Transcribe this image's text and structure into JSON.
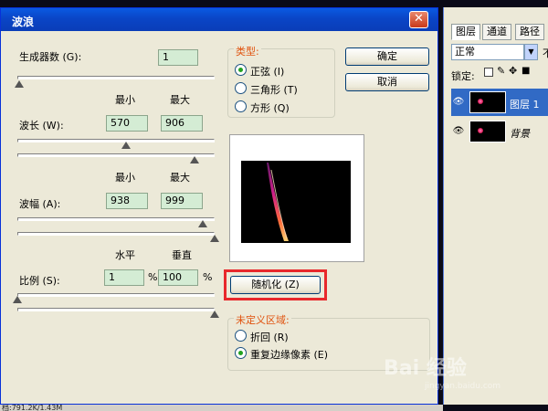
{
  "dialog": {
    "title": "波浪",
    "close_glyph": "✕",
    "generators": {
      "label": "生成器数 (G):",
      "value": "1"
    },
    "wavelength": {
      "label": "波长 (W):",
      "min_header": "最小",
      "max_header": "最大",
      "min": "570",
      "max": "906",
      "min_level": 0.55,
      "max_level": 0.9
    },
    "amplitude": {
      "label": "波幅 (A):",
      "min_header": "最小",
      "max_header": "最大",
      "min": "938",
      "max": "999",
      "min_level": 0.94,
      "max_level": 1.0
    },
    "scale": {
      "label": "比例 (S):",
      "h_header": "水平",
      "v_header": "垂直",
      "h": "1",
      "v": "100",
      "unit": "%",
      "h_level": 0.0,
      "v_level": 1.0
    },
    "type_group": {
      "title": "类型:",
      "options": [
        {
          "label": "正弦 (I)",
          "selected": true
        },
        {
          "label": "三角形 (T)",
          "selected": false
        },
        {
          "label": "方形 (Q)",
          "selected": false
        }
      ]
    },
    "ok_label": "确定",
    "cancel_label": "取消",
    "randomize_label": "随机化 (Z)",
    "undefined_group": {
      "title": "未定义区域:",
      "options": [
        {
          "label": "折回 (R)",
          "selected": false
        },
        {
          "label": "重复边缘像素 (E)",
          "selected": true
        }
      ]
    }
  },
  "panel": {
    "tabs": [
      "图层",
      "通道",
      "路径"
    ],
    "blend_mode": "正常",
    "opacity_label": "不",
    "lock_label": "锁定:",
    "layers": [
      {
        "name": "图层 1",
        "selected": true
      },
      {
        "name": "背景",
        "selected": false
      }
    ]
  },
  "status": {
    "text": "档:791.2K/1.43M"
  },
  "watermark": {
    "main": "Bai 经验",
    "sub": "jingyan.baidu.com"
  },
  "colors": {
    "title_bar": "#0a45c6",
    "accent_orange": "#e0520e",
    "highlight_red": "#e8282c",
    "field_green": "#d4ecd4"
  }
}
